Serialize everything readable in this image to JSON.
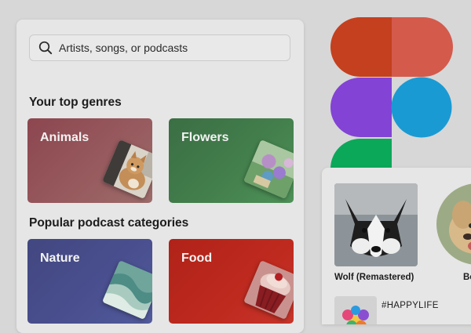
{
  "search": {
    "placeholder": "Artists, songs, or podcasts",
    "icon": "search-icon"
  },
  "sections": {
    "top_genres": {
      "title": "Your top genres",
      "cards": [
        {
          "label": "Animals",
          "color": "#8a4d55",
          "art": "cat-photo"
        },
        {
          "label": "Flowers",
          "color": "#3f7f4f",
          "art": "flower-photo"
        }
      ]
    },
    "podcast_categories": {
      "title": "Popular podcast categories",
      "cards": [
        {
          "label": "Nature",
          "color": "#474d8a",
          "art": "wave-photo"
        },
        {
          "label": "Food",
          "color": "#b8291f",
          "art": "cupcake-photo"
        }
      ]
    }
  },
  "logo": {
    "name": "figma-logo",
    "colors": {
      "red": "#c4401e",
      "coral": "#d45a4c",
      "purple": "#8343d4",
      "blue": "#1a9ad3",
      "green": "#0ca85a"
    }
  },
  "playlist": {
    "items": [
      {
        "title": "Wolf (Remastered)",
        "art": "husky-photo"
      },
      {
        "title": "Bo",
        "art": "puppy-photo"
      }
    ],
    "tag": "#HAPPYLIFE"
  }
}
